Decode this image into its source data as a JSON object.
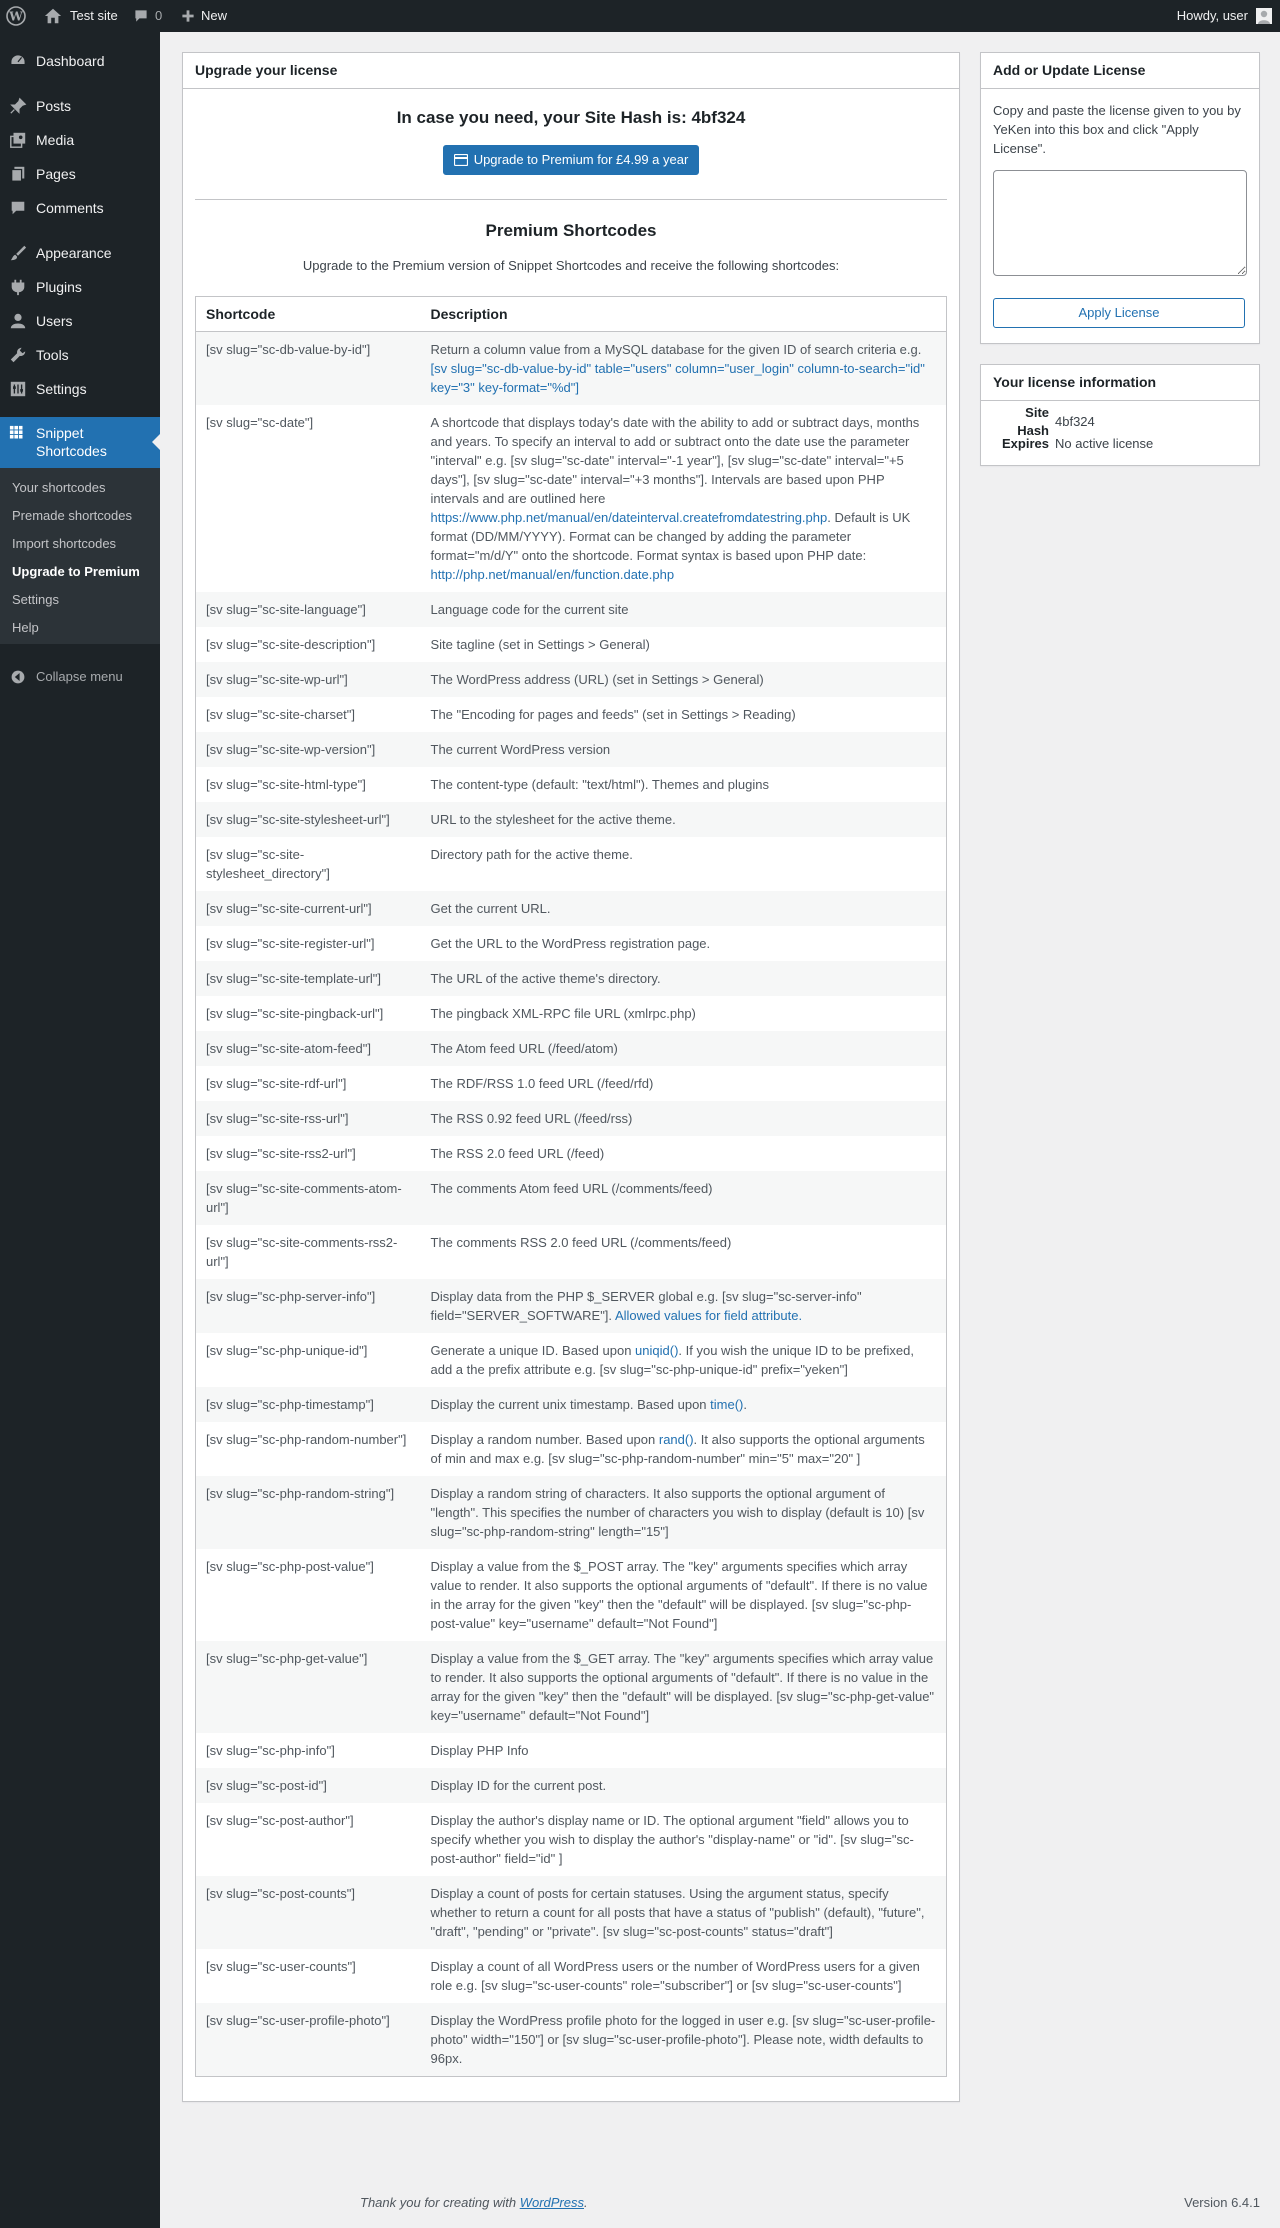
{
  "adminbar": {
    "site_name": "Test site",
    "comment_count": "0",
    "new_label": "New",
    "howdy": "Howdy, user"
  },
  "sidebar": {
    "items": [
      {
        "label": "Dashboard",
        "icon": "dashboard-icon"
      },
      {
        "label": "Posts",
        "icon": "pushpin-icon"
      },
      {
        "label": "Media",
        "icon": "media-icon"
      },
      {
        "label": "Pages",
        "icon": "pages-icon"
      },
      {
        "label": "Comments",
        "icon": "comments-icon"
      },
      {
        "label": "Appearance",
        "icon": "brush-icon"
      },
      {
        "label": "Plugins",
        "icon": "plugin-icon"
      },
      {
        "label": "Users",
        "icon": "users-icon"
      },
      {
        "label": "Tools",
        "icon": "wrench-icon"
      },
      {
        "label": "Settings",
        "icon": "settings-icon"
      }
    ],
    "current": {
      "label": "Snippet Shortcodes",
      "icon": "grid-icon"
    },
    "submenu": [
      "Your shortcodes",
      "Premade shortcodes",
      "Import shortcodes",
      "Upgrade to Premium",
      "Settings",
      "Help"
    ],
    "submenu_current": "Upgrade to Premium",
    "collapse_label": "Collapse menu"
  },
  "main": {
    "box_title": "Upgrade your license",
    "hash_heading": "In case you need, your Site Hash is: 4bf324",
    "upgrade_button": "Upgrade to Premium for £4.99 a year",
    "premium_title": "Premium Shortcodes",
    "premium_desc": "Upgrade to the Premium version of Snippet Shortcodes and receive the following shortcodes:",
    "table": {
      "headers": [
        "Shortcode",
        "Description"
      ],
      "rows": [
        {
          "code": "[sv slug=\"sc-db-value-by-id\"]",
          "desc": [
            {
              "t": "Return a column value from a MySQL database for the given ID of search criteria e.g. "
            },
            {
              "t": "[sv slug=\"sc-db-value-by-id\" table=\"users\" column=\"user_login\" column-to-search=\"id\" key=\"3\" key-format=\"%d\"]",
              "link": true
            }
          ]
        },
        {
          "code": "[sv slug=\"sc-date\"]",
          "desc": [
            {
              "t": "A shortcode that displays today's date with the ability to add or subtract days, months and years. To specify an interval to add or subtract onto the date use the parameter \"interval\" e.g. [sv slug=\"sc-date\" interval=\"-1 year\"], [sv slug=\"sc-date\" interval=\"+5 days\"], [sv slug=\"sc-date\" interval=\"+3 months\"]. Intervals are based upon PHP intervals and are outlined here "
            },
            {
              "t": "https://www.php.net/manual/en/dateinterval.createfromdatestring.php",
              "link": true
            },
            {
              "t": ". Default is UK format (DD/MM/YYYY). Format can be changed by adding the parameter format=\"m/d/Y\" onto the shortcode. Format syntax is based upon PHP date: "
            },
            {
              "t": "http://php.net/manual/en/function.date.php",
              "link": true
            }
          ]
        },
        {
          "code": "[sv slug=\"sc-site-language\"]",
          "desc": [
            {
              "t": "Language code for the current site"
            }
          ]
        },
        {
          "code": "[sv slug=\"sc-site-description\"]",
          "desc": [
            {
              "t": "Site tagline (set in Settings > General)"
            }
          ]
        },
        {
          "code": "[sv slug=\"sc-site-wp-url\"]",
          "desc": [
            {
              "t": "The WordPress address (URL) (set in Settings > General)"
            }
          ]
        },
        {
          "code": "[sv slug=\"sc-site-charset\"]",
          "desc": [
            {
              "t": "The \"Encoding for pages and feeds\" (set in Settings > Reading)"
            }
          ]
        },
        {
          "code": "[sv slug=\"sc-site-wp-version\"]",
          "desc": [
            {
              "t": "The current WordPress version"
            }
          ]
        },
        {
          "code": "[sv slug=\"sc-site-html-type\"]",
          "desc": [
            {
              "t": "The content-type (default: \"text/html\"). Themes and plugins"
            }
          ]
        },
        {
          "code": "[sv slug=\"sc-site-stylesheet-url\"]",
          "desc": [
            {
              "t": "URL to the stylesheet for the active theme."
            }
          ]
        },
        {
          "code": "[sv slug=\"sc-site-stylesheet_directory\"]",
          "desc": [
            {
              "t": "Directory path for the active theme."
            }
          ]
        },
        {
          "code": "[sv slug=\"sc-site-current-url\"]",
          "desc": [
            {
              "t": "Get the current URL."
            }
          ]
        },
        {
          "code": "[sv slug=\"sc-site-register-url\"]",
          "desc": [
            {
              "t": "Get the URL to the WordPress registration page."
            }
          ]
        },
        {
          "code": "[sv slug=\"sc-site-template-url\"]",
          "desc": [
            {
              "t": "The URL of the active theme's directory."
            }
          ]
        },
        {
          "code": "[sv slug=\"sc-site-pingback-url\"]",
          "desc": [
            {
              "t": "The pingback XML-RPC file URL (xmlrpc.php)"
            }
          ]
        },
        {
          "code": "[sv slug=\"sc-site-atom-feed\"]",
          "desc": [
            {
              "t": "The Atom feed URL (/feed/atom)"
            }
          ]
        },
        {
          "code": "[sv slug=\"sc-site-rdf-url\"]",
          "desc": [
            {
              "t": "The RDF/RSS 1.0 feed URL (/feed/rfd)"
            }
          ]
        },
        {
          "code": "[sv slug=\"sc-site-rss-url\"]",
          "desc": [
            {
              "t": "The RSS 0.92 feed URL (/feed/rss)"
            }
          ]
        },
        {
          "code": "[sv slug=\"sc-site-rss2-url\"]",
          "desc": [
            {
              "t": "The RSS 2.0 feed URL (/feed)"
            }
          ]
        },
        {
          "code": "[sv slug=\"sc-site-comments-atom-url\"]",
          "desc": [
            {
              "t": "The comments Atom feed URL (/comments/feed)"
            }
          ]
        },
        {
          "code": "[sv slug=\"sc-site-comments-rss2-url\"]",
          "desc": [
            {
              "t": "The comments RSS 2.0 feed URL (/comments/feed)"
            }
          ]
        },
        {
          "code": "[sv slug=\"sc-php-server-info\"]",
          "desc": [
            {
              "t": "Display data from the PHP $_SERVER global e.g. [sv slug=\"sc-server-info\" field=\"SERVER_SOFTWARE\"]. "
            },
            {
              "t": "Allowed values for field attribute.",
              "link": true
            }
          ]
        },
        {
          "code": "[sv slug=\"sc-php-unique-id\"]",
          "desc": [
            {
              "t": "Generate a unique ID. Based upon "
            },
            {
              "t": "uniqid()",
              "link": true
            },
            {
              "t": ". If you wish the unique ID to be prefixed, add a the prefix attribute e.g. [sv slug=\"sc-php-unique-id\" prefix=\"yeken\"]"
            }
          ]
        },
        {
          "code": "[sv slug=\"sc-php-timestamp\"]",
          "desc": [
            {
              "t": "Display the current unix timestamp. Based upon "
            },
            {
              "t": "time()",
              "link": true
            },
            {
              "t": "."
            }
          ]
        },
        {
          "code": "[sv slug=\"sc-php-random-number\"]",
          "desc": [
            {
              "t": "Display a random number. Based upon "
            },
            {
              "t": "rand()",
              "link": true
            },
            {
              "t": ". It also supports the optional arguments of min and max e.g. [sv slug=\"sc-php-random-number\" min=\"5\" max=\"20\" ]"
            }
          ]
        },
        {
          "code": "[sv slug=\"sc-php-random-string\"]",
          "desc": [
            {
              "t": "Display a random string of characters. It also supports the optional argument of \"length\". This specifies the number of characters you wish to display (default is 10) [sv slug=\"sc-php-random-string\" length=\"15\"]"
            }
          ]
        },
        {
          "code": "[sv slug=\"sc-php-post-value\"]",
          "desc": [
            {
              "t": "Display a value from the $_POST array. The \"key\" arguments specifies which array value to render. It also supports the optional arguments of \"default\". If there is no value in the array for the given \"key\" then the \"default\" will be displayed. [sv slug=\"sc-php-post-value\" key=\"username\" default=\"Not Found\"]"
            }
          ]
        },
        {
          "code": "[sv slug=\"sc-php-get-value\"]",
          "desc": [
            {
              "t": "Display a value from the $_GET array. The \"key\" arguments specifies which array value to render. It also supports the optional arguments of \"default\". If there is no value in the array for the given \"key\" then the \"default\" will be displayed. [sv slug=\"sc-php-get-value\" key=\"username\" default=\"Not Found\"]"
            }
          ]
        },
        {
          "code": "[sv slug=\"sc-php-info\"]",
          "desc": [
            {
              "t": "Display PHP Info"
            }
          ]
        },
        {
          "code": "[sv slug=\"sc-post-id\"]",
          "desc": [
            {
              "t": "Display ID for the current post."
            }
          ]
        },
        {
          "code": "[sv slug=\"sc-post-author\"]",
          "desc": [
            {
              "t": "Display the author's display name or ID. The optional argument \"field\" allows you to specify whether you wish to display the author's \"display-name\" or \"id\". [sv slug=\"sc-post-author\" field=\"id\" ]"
            }
          ]
        },
        {
          "code": "[sv slug=\"sc-post-counts\"]",
          "desc": [
            {
              "t": "Display a count of posts for certain statuses. Using the argument status, specify whether to return a count for all posts that have a status of \"publish\" (default), \"future\", \"draft\", \"pending\" or \"private\". [sv slug=\"sc-post-counts\" status=\"draft\"]"
            }
          ]
        },
        {
          "code": "[sv slug=\"sc-user-counts\"]",
          "desc": [
            {
              "t": "Display a count of all WordPress users or the number of WordPress users for a given role e.g. [sv slug=\"sc-user-counts\" role=\"subscriber\"] or [sv slug=\"sc-user-counts\"]"
            }
          ]
        },
        {
          "code": "[sv slug=\"sc-user-profile-photo\"]",
          "desc": [
            {
              "t": "Display the WordPress profile photo for the logged in user e.g. [sv slug=\"sc-user-profile-photo\" width=\"150\"] or [sv slug=\"sc-user-profile-photo\"]. Please note, width defaults to 96px."
            }
          ]
        }
      ]
    }
  },
  "license_box": {
    "title": "Add or Update License",
    "description": "Copy and paste the license given to you by YeKen into this box and click \"Apply License\".",
    "textarea_value": "",
    "apply_button": "Apply License"
  },
  "info_box": {
    "title": "Your license information",
    "site_hash_label": "Site Hash",
    "site_hash_value": "4bf324",
    "expires_label": "Expires",
    "expires_value": "No active license"
  },
  "footer": {
    "thanks_prefix": "Thank you for creating with ",
    "thanks_link": "WordPress",
    "thanks_suffix": ".",
    "version": "Version 6.4.1"
  },
  "colors": {
    "adminbar_bg": "#1d2327",
    "accent": "#2271b1",
    "submenu_bg": "#2c3338",
    "page_bg": "#f0f0f1"
  }
}
